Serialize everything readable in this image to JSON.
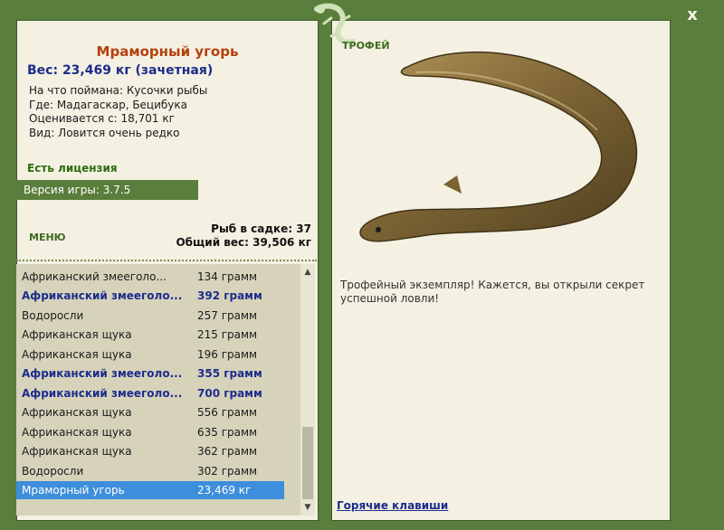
{
  "window": {
    "close_label": "x"
  },
  "catch": {
    "title": "Мраморный угорь",
    "weight_line": "Вес: 23,469 кг (зачетная)",
    "bait": "На что поймана: Кусочки рыбы",
    "place": "Где: Мадагаскар, Бецибука",
    "valued": "Оценивается с: 18,701 кг",
    "type": "Вид: Ловится очень редко"
  },
  "license": "Есть лицензия",
  "version": "Версия игры: 3.7.5",
  "menu_label": "МЕНЮ",
  "stats": {
    "fish_in_net": "Рыб в садке: 37",
    "total_weight": "Общий вес: 39,506 кг"
  },
  "fish_list": [
    {
      "name": "Африканский змееголо...",
      "weight": "134 грамм"
    },
    {
      "name": "Африканский змееголо...",
      "weight": "392 грамм"
    },
    {
      "name": "Водоросли",
      "weight": "257 грамм"
    },
    {
      "name": "Африканская щука",
      "weight": "215 грамм"
    },
    {
      "name": "Африканская щука",
      "weight": "196 грамм"
    },
    {
      "name": "Африканский змееголо...",
      "weight": "355 грамм"
    },
    {
      "name": "Африканский змееголо...",
      "weight": "700 грамм"
    },
    {
      "name": "Африканская щука",
      "weight": "556 грамм"
    },
    {
      "name": "Африканская щука",
      "weight": "635 грамм"
    },
    {
      "name": "Африканская щука",
      "weight": "362 грамм"
    },
    {
      "name": "Водоросли",
      "weight": "302 грамм"
    },
    {
      "name": "Мраморный угорь",
      "weight": "23,469 кг"
    }
  ],
  "trophy": {
    "label": "ТРОФЕЙ",
    "text": "Трофейный экземпляр! Кажется, вы открыли секрет успешной ловли!"
  },
  "hotkeys_label": "Горячие клавиши",
  "colors": {
    "frame_green": "#5a7e3b",
    "panel_bg": "#f4f1e3",
    "title_orange": "#b5400d",
    "bold_blue": "#1d2c8c",
    "selected_blue": "#3d8edb"
  },
  "icons": {
    "close": "close-icon",
    "logo": "lizard-logo-icon",
    "scroll_up": "scroll-up-arrow-icon",
    "scroll_down": "scroll-down-arrow-icon"
  }
}
